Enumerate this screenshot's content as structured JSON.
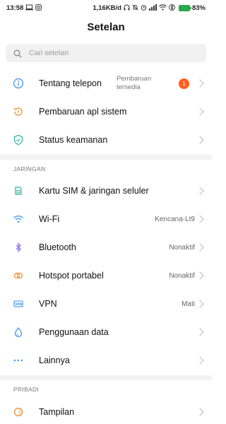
{
  "status_bar": {
    "time": "13:58",
    "net_speed": "1,16KB/d",
    "battery": "83%"
  },
  "page": {
    "title": "Setelan"
  },
  "search": {
    "placeholder": "Cari setelan"
  },
  "top_items": [
    {
      "label": "Tentang telepon",
      "sub1": "Pembaruan",
      "sub2": "tersedia",
      "badge": "1",
      "icon": "info-icon"
    },
    {
      "label": "Pembaruan apl sistem",
      "icon": "system-update-icon"
    },
    {
      "label": "Status keamanan",
      "icon": "security-shield-icon"
    }
  ],
  "sections": {
    "network": {
      "header": "JARINGAN"
    },
    "personal": {
      "header": "PRIBADI"
    }
  },
  "network_items": [
    {
      "label": "Kartu SIM & jaringan seluler",
      "value": "",
      "icon": "sim-card-icon"
    },
    {
      "label": "Wi-Fi",
      "value": "Kencana-Lt9",
      "icon": "wifi-icon"
    },
    {
      "label": "Bluetooth",
      "value": "Nonaktif",
      "icon": "bluetooth-icon"
    },
    {
      "label": "Hotspot portabel",
      "value": "Nonaktif",
      "icon": "hotspot-icon"
    },
    {
      "label": "VPN",
      "value": "Mati",
      "icon": "vpn-icon"
    },
    {
      "label": "Penggunaan data",
      "value": "",
      "icon": "data-usage-icon"
    },
    {
      "label": "Lainnya",
      "value": "",
      "icon": "more-dots-icon"
    }
  ],
  "personal_items": [
    {
      "label": "Tampilan",
      "value": "",
      "icon": "display-icon"
    }
  ],
  "colors": {
    "accent_blue": "#3a8ee6",
    "accent_orange": "#f08a24",
    "accent_teal": "#2bb5a0",
    "accent_purple": "#8a6be8",
    "badge": "#ff5e1f"
  }
}
